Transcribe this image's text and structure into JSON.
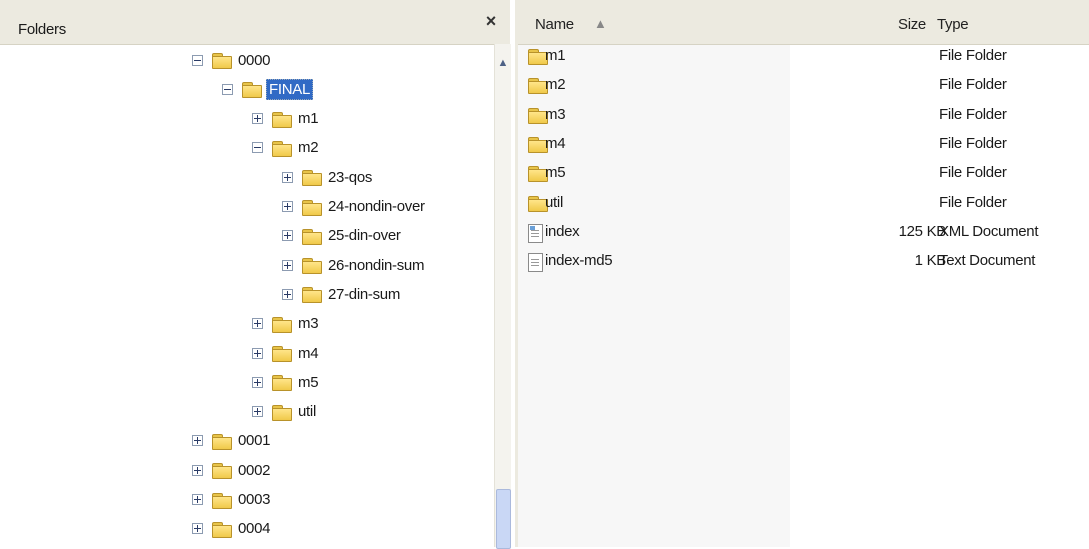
{
  "folders_pane": {
    "title": "Folders",
    "close_symbol": "×",
    "tree": [
      {
        "label": "0000",
        "expander": "minus",
        "depth": 0
      },
      {
        "label": "FINAL",
        "expander": "minus",
        "depth": 1,
        "selected": true
      },
      {
        "label": "m1",
        "expander": "plus",
        "depth": 2
      },
      {
        "label": "m2",
        "expander": "minus",
        "depth": 2
      },
      {
        "label": "23-qos",
        "expander": "plus",
        "depth": 3
      },
      {
        "label": "24-nondin-over",
        "expander": "plus",
        "depth": 3
      },
      {
        "label": "25-din-over",
        "expander": "plus",
        "depth": 3
      },
      {
        "label": "26-nondin-sum",
        "expander": "plus",
        "depth": 3
      },
      {
        "label": "27-din-sum",
        "expander": "plus",
        "depth": 3
      },
      {
        "label": "m3",
        "expander": "plus",
        "depth": 2
      },
      {
        "label": "m4",
        "expander": "plus",
        "depth": 2
      },
      {
        "label": "m5",
        "expander": "plus",
        "depth": 2
      },
      {
        "label": "util",
        "expander": "plus",
        "depth": 2
      },
      {
        "label": "0001",
        "expander": "plus",
        "depth": 0
      },
      {
        "label": "0002",
        "expander": "plus",
        "depth": 0
      },
      {
        "label": "0003",
        "expander": "plus",
        "depth": 0
      },
      {
        "label": "0004",
        "expander": "plus",
        "depth": 0
      }
    ]
  },
  "list_pane": {
    "columns": {
      "name": "Name",
      "sort_indicator": "▲",
      "size": "Size",
      "type": "Type"
    },
    "files": [
      {
        "name": "m1",
        "size": "",
        "type": "File Folder",
        "icon": "folder-icon"
      },
      {
        "name": "m2",
        "size": "",
        "type": "File Folder",
        "icon": "folder-icon"
      },
      {
        "name": "m3",
        "size": "",
        "type": "File Folder",
        "icon": "folder-icon"
      },
      {
        "name": "m4",
        "size": "",
        "type": "File Folder",
        "icon": "folder-icon"
      },
      {
        "name": "m5",
        "size": "",
        "type": "File Folder",
        "icon": "folder-icon"
      },
      {
        "name": "util",
        "size": "",
        "type": "File Folder",
        "icon": "folder-icon"
      },
      {
        "name": "index",
        "size": "125 KB",
        "type": "XML Document",
        "icon": "xml-document-icon"
      },
      {
        "name": "index-md5",
        "size": "1 KB",
        "type": "Text Document",
        "icon": "text-document-icon"
      }
    ]
  }
}
